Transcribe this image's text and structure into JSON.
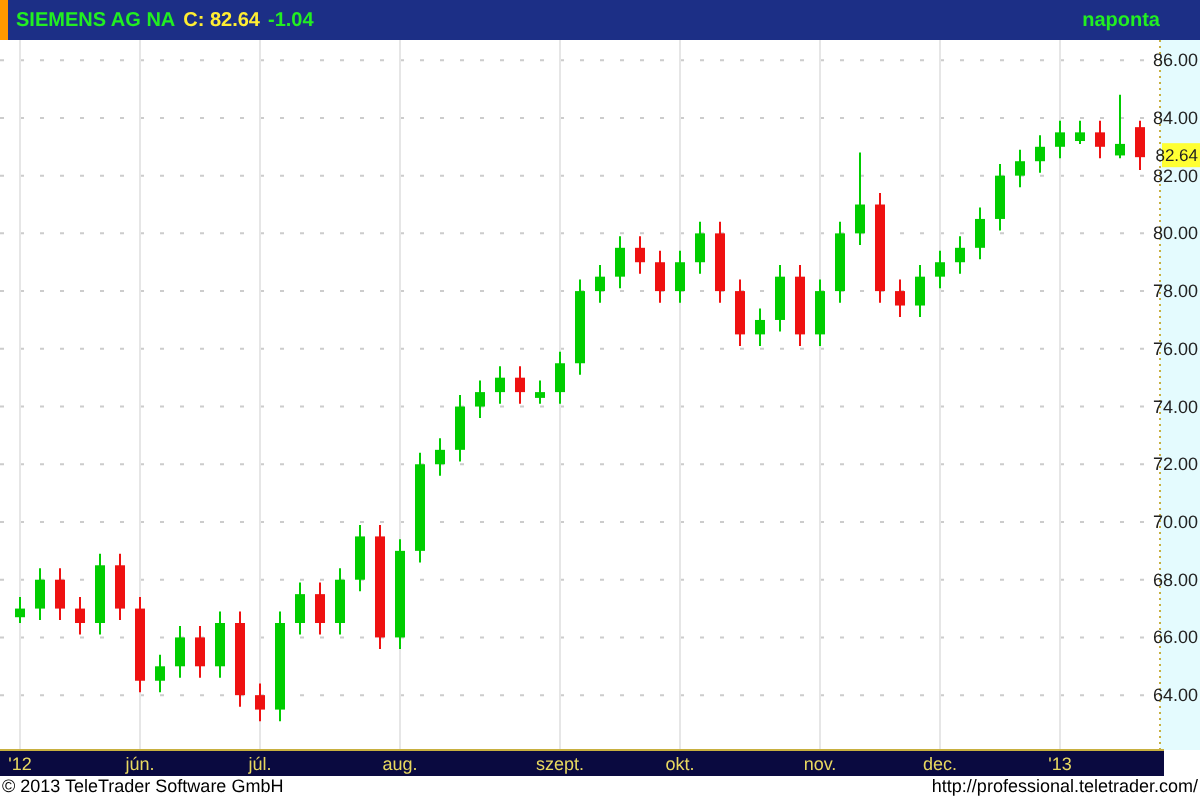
{
  "header": {
    "symbol": "SIEMENS AG NA",
    "close": "C: 82.64",
    "change": "-1.04",
    "interval": "naponta"
  },
  "chart": {
    "last_price_label": "82.64",
    "chart_data": {
      "type": "candlestick",
      "categories": [
        "'12",
        null,
        null,
        null,
        null,
        null,
        "jún.",
        null,
        null,
        null,
        null,
        null,
        "júl.",
        null,
        null,
        null,
        null,
        null,
        null,
        "aug.",
        null,
        null,
        null,
        null,
        null,
        null,
        null,
        "szept.",
        null,
        null,
        null,
        null,
        null,
        "okt.",
        null,
        null,
        null,
        null,
        null,
        null,
        "nov.",
        null,
        null,
        null,
        null,
        null,
        "dec.",
        null,
        null,
        null,
        null,
        null,
        "'13",
        null,
        null,
        null,
        null
      ],
      "ohlc": [
        [
          66.7,
          67.4,
          66.5,
          67
        ],
        [
          67,
          68.4,
          66.6,
          68
        ],
        [
          68,
          68.4,
          66.6,
          67
        ],
        [
          67,
          67.4,
          66.1,
          66.5
        ],
        [
          66.5,
          68.9,
          66.1,
          68.5
        ],
        [
          68.5,
          68.9,
          66.6,
          67
        ],
        [
          67,
          67.4,
          64.1,
          64.5
        ],
        [
          64.5,
          65.4,
          64.1,
          65
        ],
        [
          65,
          66.4,
          64.6,
          66
        ],
        [
          66,
          66.4,
          64.6,
          65
        ],
        [
          65,
          66.9,
          64.6,
          66.5
        ],
        [
          66.5,
          66.9,
          63.6,
          64
        ],
        [
          64,
          64.4,
          63.1,
          63.5
        ],
        [
          63.5,
          66.9,
          63.1,
          66.5
        ],
        [
          66.5,
          67.9,
          66.1,
          67.5
        ],
        [
          67.5,
          67.9,
          66.1,
          66.5
        ],
        [
          66.5,
          68.4,
          66.1,
          68
        ],
        [
          68,
          69.9,
          67.6,
          69.5
        ],
        [
          69.5,
          69.9,
          65.6,
          66
        ],
        [
          66,
          69.4,
          65.6,
          69
        ],
        [
          69,
          72.4,
          68.6,
          72
        ],
        [
          72,
          72.9,
          71.6,
          72.5
        ],
        [
          72.5,
          74.4,
          72.1,
          74
        ],
        [
          74,
          74.9,
          73.6,
          74.5
        ],
        [
          74.5,
          75.4,
          74.1,
          75
        ],
        [
          75,
          75.4,
          74.1,
          74.5
        ],
        [
          74.3,
          74.9,
          74.1,
          74.5
        ],
        [
          74.5,
          75.9,
          74.1,
          75.5
        ],
        [
          75.5,
          78.4,
          75.1,
          78
        ],
        [
          78,
          78.9,
          77.6,
          78.5
        ],
        [
          78.5,
          79.9,
          78.1,
          79.5
        ],
        [
          79.5,
          79.9,
          78.6,
          79
        ],
        [
          79,
          79.4,
          77.6,
          78
        ],
        [
          78,
          79.4,
          77.6,
          79
        ],
        [
          79,
          80.4,
          78.6,
          80
        ],
        [
          80,
          80.4,
          77.6,
          78
        ],
        [
          78,
          78.4,
          76.1,
          76.5
        ],
        [
          76.5,
          77.4,
          76.1,
          77
        ],
        [
          77,
          78.9,
          76.6,
          78.5
        ],
        [
          78.5,
          78.9,
          76.1,
          76.5
        ],
        [
          76.5,
          78.4,
          76.1,
          78
        ],
        [
          78,
          80.4,
          77.6,
          80
        ],
        [
          80,
          82.8,
          79.6,
          81
        ],
        [
          81,
          81.4,
          77.6,
          78
        ],
        [
          78,
          78.4,
          77.1,
          77.5
        ],
        [
          77.5,
          78.9,
          77.1,
          78.5
        ],
        [
          78.5,
          79.4,
          78.1,
          79
        ],
        [
          79,
          79.9,
          78.6,
          79.5
        ],
        [
          79.5,
          80.9,
          79.1,
          80.5
        ],
        [
          80.5,
          82.4,
          80.1,
          82
        ],
        [
          82,
          82.9,
          81.6,
          82.5
        ],
        [
          82.5,
          83.4,
          82.1,
          83
        ],
        [
          83,
          83.9,
          82.6,
          83.5
        ],
        [
          83.2,
          83.9,
          83.1,
          83.5
        ],
        [
          83.5,
          83.9,
          82.6,
          83
        ],
        [
          82.7,
          84.8,
          82.6,
          83.1
        ],
        [
          83.68,
          83.9,
          82.2,
          82.64
        ]
      ],
      "ylim": [
        62.1,
        86.7
      ],
      "grid": true,
      "yticks": [
        {
          "value": 64,
          "label": "64.00"
        },
        {
          "value": 66,
          "label": "66.00"
        },
        {
          "value": 68,
          "label": "68.00"
        },
        {
          "value": 70,
          "label": "70.00"
        },
        {
          "value": 72,
          "label": "72.00"
        },
        {
          "value": 74,
          "label": "74.00"
        },
        {
          "value": 76,
          "label": "76.00"
        },
        {
          "value": 78,
          "label": "78.00"
        },
        {
          "value": 80,
          "label": "80.00"
        },
        {
          "value": 82,
          "label": "82.00"
        },
        {
          "value": 84,
          "label": "84.00"
        },
        {
          "value": 86,
          "label": "86.00"
        }
      ]
    }
  },
  "footer": {
    "copyright": "© 2013 TeleTrader Software GmbH",
    "url": "http://professional.teletrader.com/"
  }
}
